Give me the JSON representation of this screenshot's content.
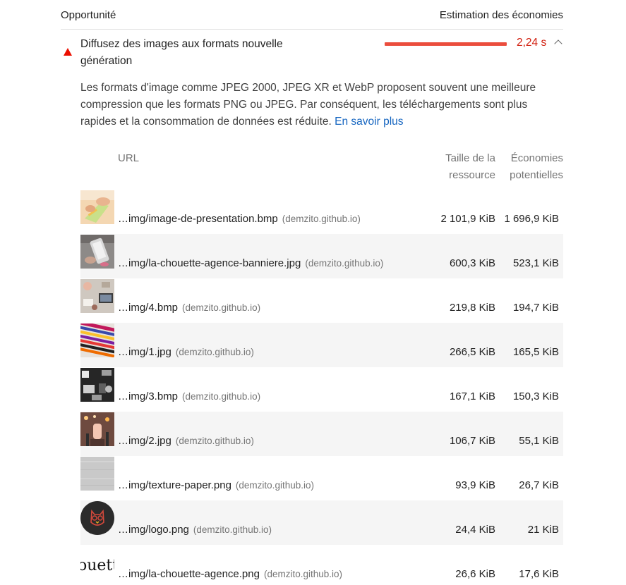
{
  "header": {
    "left_label": "Opportunité",
    "right_label": "Estimation des économies"
  },
  "audit": {
    "title": "Diffusez des images aux formats nouvelle génération",
    "savings": "2,24 s",
    "description": "Les formats d'image comme JPEG 2000, JPEG XR et WebP proposent souvent une meilleure compression que les formats PNG ou JPEG. Par conséquent, les téléchargements sont plus rapides et la consommation de données est réduite.",
    "learn_more": "En savoir plus",
    "status_color": "#eb0f00"
  },
  "table": {
    "columns": {
      "url": "URL",
      "resource_size": "Taille de la ressource",
      "potential_savings": "Économies potentielles"
    },
    "rows": [
      {
        "url": "…img/image-de-presentation.bmp",
        "origin": "(demzito.github.io)",
        "size": "2 101,9 KiB",
        "savings": "1 696,9 KiB"
      },
      {
        "url": "…img/la-chouette-agence-banniere.jpg",
        "origin": "(demzito.github.io)",
        "size": "600,3 KiB",
        "savings": "523,1 KiB"
      },
      {
        "url": "…img/4.bmp",
        "origin": "(demzito.github.io)",
        "size": "219,8 KiB",
        "savings": "194,7 KiB"
      },
      {
        "url": "…img/1.jpg",
        "origin": "(demzito.github.io)",
        "size": "266,5 KiB",
        "savings": "165,5 KiB"
      },
      {
        "url": "…img/3.bmp",
        "origin": "(demzito.github.io)",
        "size": "167,1 KiB",
        "savings": "150,3 KiB"
      },
      {
        "url": "…img/2.jpg",
        "origin": "(demzito.github.io)",
        "size": "106,7 KiB",
        "savings": "55,1 KiB"
      },
      {
        "url": "…img/texture-paper.png",
        "origin": "(demzito.github.io)",
        "size": "93,9 KiB",
        "savings": "26,7 KiB"
      },
      {
        "url": "…img/logo.png",
        "origin": "(demzito.github.io)",
        "size": "24,4 KiB",
        "savings": "21 KiB"
      },
      {
        "url": "…img/la-chouette-agence.png",
        "origin": "(demzito.github.io)",
        "size": "26,6 KiB",
        "savings": "17,6 KiB"
      }
    ]
  },
  "thumbnails": [
    "thumb-presentation",
    "thumb-banner",
    "thumb-4",
    "thumb-1",
    "thumb-3",
    "thumb-2",
    "thumb-texture",
    "thumb-logo",
    "thumb-wordmark"
  ],
  "logo_text": "ouett"
}
